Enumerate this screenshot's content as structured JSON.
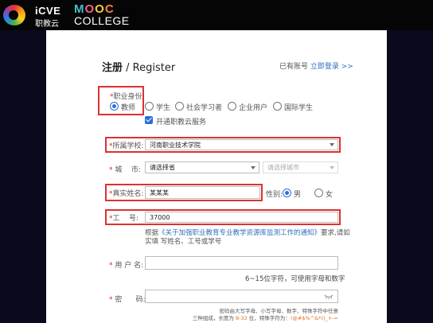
{
  "header": {
    "icve_logo": "iCVE",
    "icve_sub": "职教云",
    "mooc_letters": [
      "M",
      "O",
      "O",
      "C"
    ],
    "college": "COLLEGE"
  },
  "form": {
    "title_cn": "注册",
    "title_sep": " / ",
    "title_en": "Register",
    "has_account": "已有账号",
    "login_link": "立即登录 >>",
    "identity": {
      "label": "职业身份:",
      "options": [
        "教师",
        "学生",
        "社会学习者",
        "企业用户",
        "国际学生"
      ],
      "selected": "教师"
    },
    "open_service": {
      "label": "开通职教云服务",
      "checked": true
    },
    "school": {
      "label": "所属学校:",
      "value": "河南职业技术学院"
    },
    "city": {
      "label_a": "城",
      "label_b": "市:",
      "province_value": "请选择省",
      "city_placeholder": "请选择城市"
    },
    "real_name": {
      "label": "真实姓名:",
      "value": "某某某"
    },
    "gender": {
      "label": "性别:",
      "options": [
        "男",
        "女"
      ],
      "selected": "男"
    },
    "staff_id": {
      "label_a": "工",
      "label_b": "号:",
      "value": "37000"
    },
    "notice": {
      "prefix": "根据",
      "link": "《关于加强职业教育专业教学资源库监测工作的通知》",
      "suffix": "要求,请如",
      "line2": "实填 写姓名、工号或学号"
    },
    "username": {
      "label": "用 户 名:",
      "value": "",
      "help": "6~15位字符，可使用字母和数字"
    },
    "password": {
      "label_a": "密",
      "label_b": "码:",
      "value": "",
      "help_line1": "密码由大写字母、小写字母、数字、特殊字符中任意",
      "help_line2_a": "三种组成，长度为",
      "help_line2_b": "8-32",
      "help_line2_c": "位，特殊字符为：",
      "help_line2_d": "!@#$%^&*()_+-="
    },
    "required_mark": "*"
  },
  "colors": {
    "accent": "#2b6fd8",
    "highlight": "#e03030",
    "link": "#2f6fbf"
  }
}
